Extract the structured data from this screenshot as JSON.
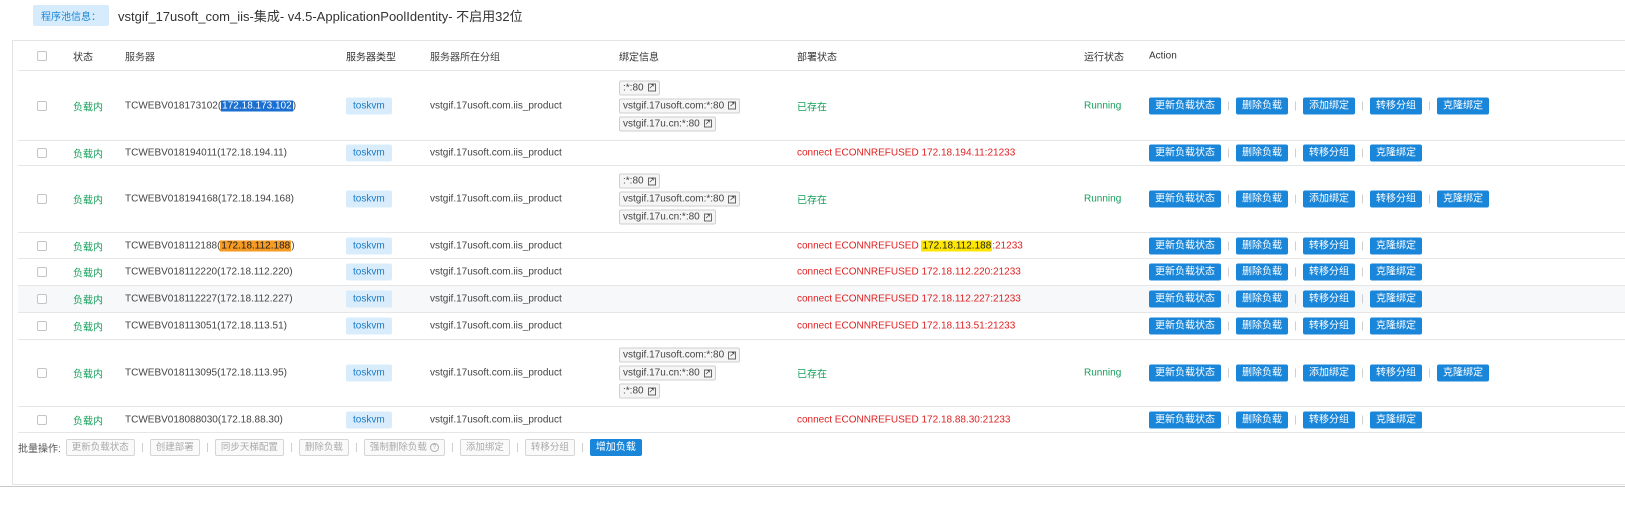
{
  "pool": {
    "label": "程序池信息：",
    "name": "vstgif_17usoft_com_iis-集成- v4.5-ApplicationPoolIdentity- 不启用32位"
  },
  "headers": {
    "status": "状态",
    "server": "服务器",
    "type": "服务器类型",
    "group": "服务器所在分组",
    "bind": "绑定信息",
    "deploy": "部署状态",
    "run": "运行状态",
    "action": "Action"
  },
  "rows": [
    {
      "status": "负载内",
      "server_name": "TCWEBV018173102(",
      "server_ip": "172.18.173.102",
      "server_suffix": ")",
      "type": "toskvm",
      "group": "vstgif.17usoft.com.iis_product",
      "bindings": [
        ":*:80",
        "vstgif.17usoft.com:*:80",
        "vstgif.17u.cn:*:80"
      ],
      "deploy": "已存在",
      "run": "Running",
      "actions": [
        "更新负载状态",
        "删除负载",
        "添加绑定",
        "转移分组",
        "克隆绑定"
      ]
    },
    {
      "status": "负载内",
      "server_name": "TCWEBV018194011(172.18.194.11)",
      "type": "toskvm",
      "group": "vstgif.17usoft.com.iis_product",
      "bindings": [],
      "deploy": "connect ECONNREFUSED 172.18.194.11:21233",
      "run": "",
      "actions": [
        "更新负载状态",
        "删除负载",
        "转移分组",
        "克隆绑定"
      ]
    },
    {
      "status": "负载内",
      "server_name": "TCWEBV018194168(172.18.194.168)",
      "type": "toskvm",
      "group": "vstgif.17usoft.com.iis_product",
      "bindings": [
        ":*:80",
        "vstgif.17usoft.com:*:80",
        "vstgif.17u.cn:*:80"
      ],
      "deploy": "已存在",
      "run": "Running",
      "actions": [
        "更新负载状态",
        "删除负载",
        "添加绑定",
        "转移分组",
        "克隆绑定"
      ]
    },
    {
      "status": "负载内",
      "server_name": "TCWEBV018112188(",
      "server_ip": "172.18.112.188",
      "server_suffix": ")",
      "type": "toskvm",
      "group": "vstgif.17usoft.com.iis_product",
      "bindings": [],
      "deploy_prefix": "connect ECONNREFUSED ",
      "deploy_ip": "172.18.112.188",
      "deploy_suffix": ":21233",
      "run": "",
      "actions": [
        "更新负载状态",
        "删除负载",
        "转移分组",
        "克隆绑定"
      ]
    },
    {
      "status": "负载内",
      "server_name": "TCWEBV018112220(172.18.112.220)",
      "type": "toskvm",
      "group": "vstgif.17usoft.com.iis_product",
      "bindings": [],
      "deploy": "connect ECONNREFUSED 172.18.112.220:21233",
      "run": "",
      "actions": [
        "更新负载状态",
        "删除负载",
        "转移分组",
        "克隆绑定"
      ]
    },
    {
      "status": "负载内",
      "server_name": "TCWEBV018112227(172.18.112.227)",
      "type": "toskvm",
      "group": "vstgif.17usoft.com.iis_product",
      "bindings": [],
      "deploy": "connect ECONNREFUSED 172.18.112.227:21233",
      "run": "",
      "actions": [
        "更新负载状态",
        "删除负载",
        "转移分组",
        "克隆绑定"
      ]
    },
    {
      "status": "负载内",
      "server_name": "TCWEBV018113051(172.18.113.51)",
      "type": "toskvm",
      "group": "vstgif.17usoft.com.iis_product",
      "bindings": [],
      "deploy": "connect ECONNREFUSED 172.18.113.51:21233",
      "run": "",
      "actions": [
        "更新负载状态",
        "删除负载",
        "转移分组",
        "克隆绑定"
      ]
    },
    {
      "status": "负载内",
      "server_name": "TCWEBV018113095(172.18.113.95)",
      "type": "toskvm",
      "group": "vstgif.17usoft.com.iis_product",
      "bindings": [
        "vstgif.17usoft.com:*:80",
        "vstgif.17u.cn:*:80",
        ":*:80"
      ],
      "deploy": "已存在",
      "run": "Running",
      "actions": [
        "更新负载状态",
        "删除负载",
        "添加绑定",
        "转移分组",
        "克隆绑定"
      ]
    },
    {
      "status": "负载内",
      "server_name": "TCWEBV018088030(172.18.88.30)",
      "type": "toskvm",
      "group": "vstgif.17usoft.com.iis_product",
      "bindings": [],
      "deploy": "connect ECONNREFUSED 172.18.88.30:21233",
      "run": "",
      "actions": [
        "更新负载状态",
        "删除负载",
        "转移分组",
        "克隆绑定"
      ]
    }
  ],
  "batch": {
    "label": "批量操作:",
    "buttons": [
      "更新负载状态",
      "创建部署",
      "同步天梯配置",
      "删除负载",
      "强制删除负载",
      "添加绑定",
      "转移分组"
    ],
    "help_icon": "?",
    "primary": "增加负载"
  },
  "icons": {
    "external_link": "external-link-icon",
    "help": "question-circle-icon"
  },
  "colors": {
    "accent": "#1a86d9",
    "success": "#14a05a",
    "error": "#e02020",
    "highlight_blue": "#1a6fd0",
    "highlight_orange": "#f59a23",
    "highlight_yellow": "#ffe600"
  }
}
